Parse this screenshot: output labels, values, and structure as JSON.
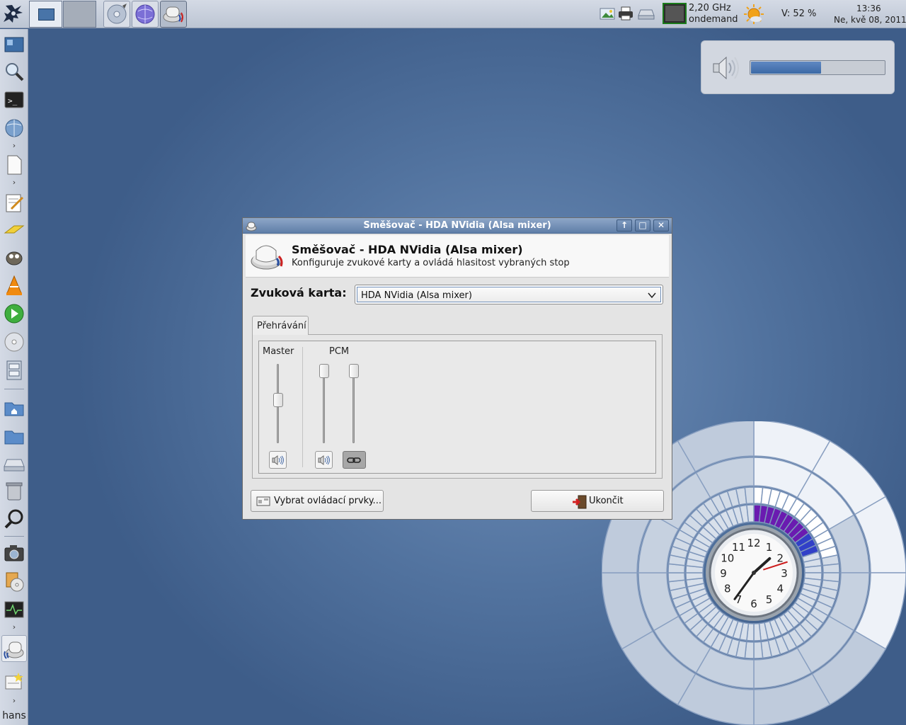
{
  "top_panel": {
    "logo_icon": "xfce-mouse-icon",
    "workspaces": [
      "workspace-1",
      "workspace-2"
    ],
    "tasks": [
      "disc-burner-icon",
      "web-browser-icon",
      "audio-mixer-icon"
    ],
    "tray_icons": [
      "image-viewer-icon",
      "printer-icon",
      "drive-icon",
      "cpu-monitor-icon",
      "weather-icon"
    ],
    "cpu_freq": "2,20 GHz",
    "cpu_governor": "ondemand",
    "volume_text": "V: 52 %",
    "time": "13:36",
    "date": "Ne, kvě 08, 2011"
  },
  "left_panel": {
    "launchers": [
      "show-desktop-icon",
      "search-icon",
      "terminal-icon",
      "network-icon",
      "document-icon",
      "text-editor-icon",
      "mail-icon",
      "gimp-icon",
      "vlc-icon",
      "media-player-icon",
      "cd-icon",
      "file-cabinet-icon",
      "home-folder-icon",
      "folder-icon",
      "drive-icon",
      "trash-icon",
      "search-icon",
      "camera-icon",
      "disc-burner-icon",
      "system-monitor-icon",
      "audio-mixer-icon",
      "notes-icon"
    ],
    "user": "hans"
  },
  "osd": {
    "icon": "speaker-icon",
    "volume_fraction": 0.52
  },
  "dialog": {
    "window_title": "Směšovač - HDA NVidia (Alsa mixer)",
    "window_buttons": {
      "up": "↑",
      "maximize": "□",
      "close": "✕"
    },
    "header_title": "Směšovač - HDA NVidia (Alsa mixer)",
    "header_subtitle": "Konfiguruje zvukové karty a ovládá hlasitost vybraných stop",
    "card_label": "Zvuková karta:",
    "card_value": "HDA NVidia (Alsa mixer)",
    "tab_label": "Přehrávání",
    "channels": {
      "master": {
        "label": "Master",
        "level": 0.55
      },
      "pcm": {
        "label": "PCM",
        "left_level": 1.0,
        "right_level": 1.0,
        "locked": true
      }
    },
    "select_controls_button": "Vybrat ovládací prvky...",
    "quit_button": "Ukončit"
  },
  "clock": {
    "hour_labels": [
      "12",
      "1",
      "2",
      "3",
      "4",
      "5",
      "6",
      "7",
      "8",
      "9",
      "10",
      "11"
    ],
    "time_shown": "1:36"
  },
  "colors": {
    "desktop": "#52739f",
    "titlebar": "#6d8bb3",
    "osd_fill": "#4a76b0",
    "clock_highlight": "#6a1bb0"
  }
}
